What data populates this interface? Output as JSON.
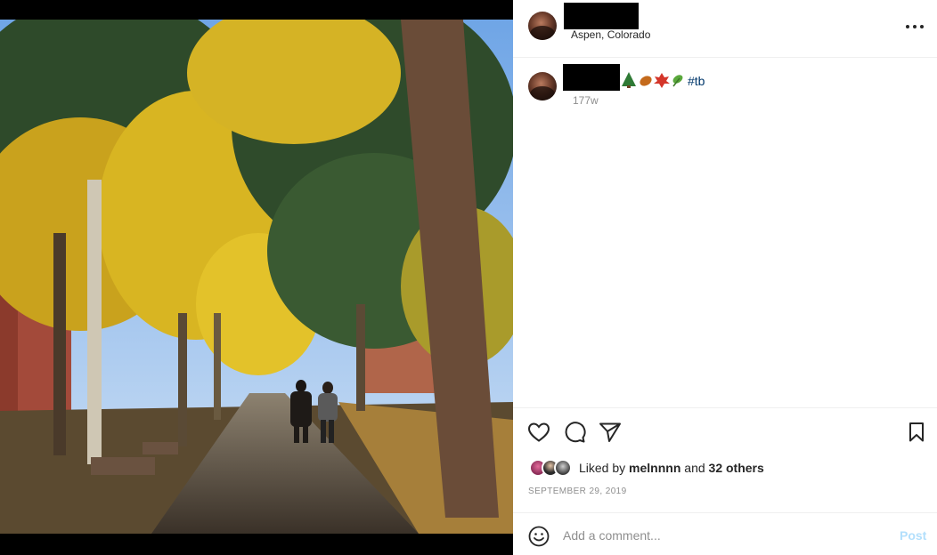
{
  "post": {
    "location": "Aspen, Colorado",
    "caption_emoji": "🌲🍂🍁🌿",
    "caption_hashtag": "#tb",
    "age": "177w",
    "date": "SEPTEMBER 29, 2019"
  },
  "likes": {
    "prefix": "Liked by ",
    "user": "melnnnn",
    "joiner": " and ",
    "others": "32 others"
  },
  "comment": {
    "placeholder": "Add a comment...",
    "post_label": "Post"
  },
  "colors": {
    "text": "#262626",
    "secondary": "#8e8e8e",
    "hashtag": "#00376b",
    "post_disabled": "#b2dffc",
    "divider": "#efefef"
  },
  "icons": [
    "more-icon",
    "heart-icon",
    "comment-bubble-icon",
    "paper-plane-icon",
    "bookmark-icon",
    "smiley-icon"
  ]
}
